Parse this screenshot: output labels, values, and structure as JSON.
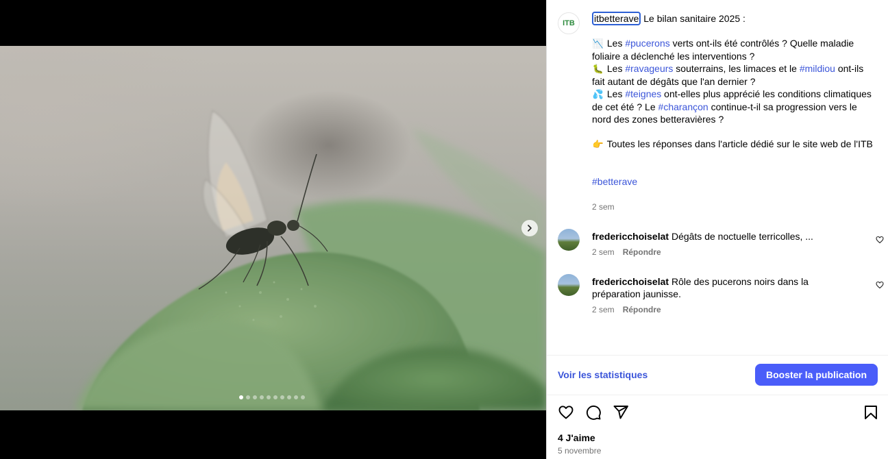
{
  "post": {
    "username": "itbetterave",
    "avatar_label": "ITB",
    "caption_intro": "Le bilan sanitaire 2025 :",
    "line1_a": "Les ",
    "line1_tag": "#pucerons",
    "line1_b": " verts ont-ils été contrôlés ? Quelle maladie foliaire a déclenché les interventions ?",
    "line2_a": "Les ",
    "line2_tag": "#ravageurs",
    "line2_b": " souterrains, les limaces et le ",
    "line2_tag2": "#mildiou",
    "line2_c": " ont-ils fait autant de dégâts que l'an dernier ?",
    "line3_a": "Les ",
    "line3_tag": "#teignes",
    "line3_b": " ont-elles plus apprécié les conditions climatiques de cet été ? Le ",
    "line3_tag2": "#charançon",
    "line3_c": " continue-t-il sa progression vers le nord des zones betteravières ?",
    "line4": "Toutes les réponses dans l'article dédié sur le site web de l'ITB",
    "footer_tag": "#betterave",
    "time": "2 sem",
    "emojis": {
      "chart": "📉",
      "bug": "🐛",
      "drops": "💦",
      "point": "👉"
    }
  },
  "comments": [
    {
      "user": "fredericchoiselat",
      "text": "Dégâts de noctuelle terricolles, ...",
      "time": "2 sem",
      "reply": "Répondre"
    },
    {
      "user": "fredericchoiselat",
      "text": "Rôle des pucerons noirs dans la préparation jaunisse.",
      "time": "2 sem",
      "reply": "Répondre"
    }
  ],
  "actions": {
    "stats": "Voir les statistiques",
    "boost": "Booster la publication"
  },
  "likes": "4 J'aime",
  "date": "5 novembre",
  "carousel": {
    "total": 10,
    "current": 1
  },
  "icons": [
    "chevron-right-icon",
    "heart-icon",
    "comment-icon",
    "share-icon",
    "bookmark-icon"
  ]
}
